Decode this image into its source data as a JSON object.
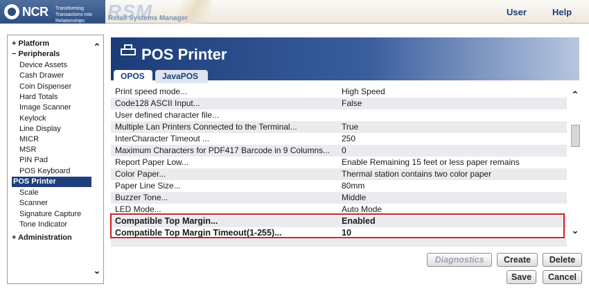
{
  "header": {
    "brand": "NCR",
    "tagline": "Transforming Transactions into Relationships",
    "product_abbr": "RSM",
    "product_name": "Retail Systems Manager",
    "user_link": "User",
    "help_link": "Help"
  },
  "sidebar": {
    "items": [
      {
        "label": "+ Platform",
        "kind": "group"
      },
      {
        "label": "− Peripherals",
        "kind": "group"
      },
      {
        "label": "Device Assets",
        "kind": "sub"
      },
      {
        "label": "Cash Drawer",
        "kind": "sub"
      },
      {
        "label": "Coin Dispenser",
        "kind": "sub"
      },
      {
        "label": "Hard Totals",
        "kind": "sub"
      },
      {
        "label": "Image Scanner",
        "kind": "sub"
      },
      {
        "label": "Keylock",
        "kind": "sub"
      },
      {
        "label": "Line Display",
        "kind": "sub"
      },
      {
        "label": "MICR",
        "kind": "sub"
      },
      {
        "label": "MSR",
        "kind": "sub"
      },
      {
        "label": "PIN Pad",
        "kind": "sub"
      },
      {
        "label": "POS Keyboard",
        "kind": "sub"
      },
      {
        "label": "POS Printer",
        "kind": "selected"
      },
      {
        "label": "Scale",
        "kind": "sub"
      },
      {
        "label": "Scanner",
        "kind": "sub"
      },
      {
        "label": "Signature Capture",
        "kind": "sub"
      },
      {
        "label": "Tone Indicator",
        "kind": "sub"
      },
      {
        "label": "+ Administration",
        "kind": "group"
      }
    ],
    "scroll_up": "^",
    "scroll_down": "v"
  },
  "main": {
    "title": "POS Printer",
    "tabs": [
      {
        "label": "OPOS",
        "active": true
      },
      {
        "label": "JavaPOS",
        "active": false
      }
    ],
    "properties": [
      {
        "name": "Print speed mode...",
        "value": "High Speed"
      },
      {
        "name": "Code128 ASCII Input...",
        "value": "False"
      },
      {
        "name": "User defined character file...",
        "value": ""
      },
      {
        "name": "Multiple Lan Printers Connected to the Terminal...",
        "value": "True"
      },
      {
        "name": "InterCharacter Timeout ...",
        "value": "250"
      },
      {
        "name": "Maximum Characters for PDF417 Barcode in 9 Columns...",
        "value": "0"
      },
      {
        "name": "Report Paper Low...",
        "value": "Enable Remaining 15 feet or less paper remains"
      },
      {
        "name": "Color Paper...",
        "value": "Thermal station contains two color paper"
      },
      {
        "name": "Paper Line Size...",
        "value": "80mm"
      },
      {
        "name": "Buzzer Tone...",
        "value": "Middle"
      },
      {
        "name": "LED Mode...",
        "value": "Auto Mode"
      },
      {
        "name": "Compatible Top Margin...",
        "value": "Enabled",
        "highlighted": true
      },
      {
        "name": "Compatible Top Margin Timeout(1-255)...",
        "value": "10",
        "highlighted": true
      }
    ]
  },
  "buttons": {
    "diagnostics": "Diagnostics",
    "create": "Create",
    "delete": "Delete",
    "save": "Save",
    "cancel": "Cancel"
  },
  "colors": {
    "nav_selected": "#1f3f7c",
    "banner": "#1b3c78",
    "highlight_box": "#d01e1e",
    "alt_row": "#e9ebee"
  }
}
